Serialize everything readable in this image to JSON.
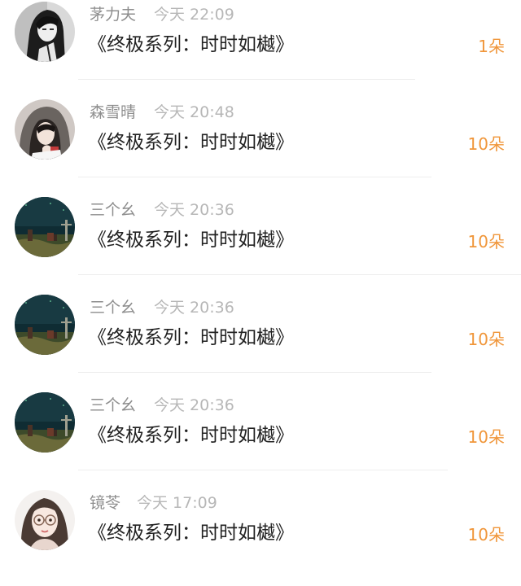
{
  "feed": {
    "items": [
      {
        "user": "茅力夫",
        "time": "今天 22:09",
        "title": "《终极系列：时时如樾》",
        "gift": "1朵",
        "avatar_icon": "dark-portrait-avatar"
      },
      {
        "user": "森雪晴",
        "time": "今天 20:48",
        "title": "《终极系列：时时如樾》",
        "gift": "10朵",
        "avatar_icon": "hooded-girl-avatar"
      },
      {
        "user": "三个幺",
        "time": "今天 20:36",
        "title": "《终极系列：时时如樾》",
        "gift": "10朵",
        "avatar_icon": "night-landscape-avatar"
      },
      {
        "user": "三个幺",
        "time": "今天 20:36",
        "title": "《终极系列：时时如樾》",
        "gift": "10朵",
        "avatar_icon": "night-landscape-avatar"
      },
      {
        "user": "三个幺",
        "time": "今天 20:36",
        "title": "《终极系列：时时如樾》",
        "gift": "10朵",
        "avatar_icon": "night-landscape-avatar"
      },
      {
        "user": "镜苓",
        "time": "今天 17:09",
        "title": "《终极系列：时时如樾》",
        "gift": "10朵",
        "avatar_icon": "glasses-girl-avatar"
      }
    ]
  },
  "colors": {
    "gift": "#f0963a",
    "username": "#8e8e8e",
    "time": "#b7b7b7",
    "title": "#222222",
    "divider": "#ededed"
  }
}
